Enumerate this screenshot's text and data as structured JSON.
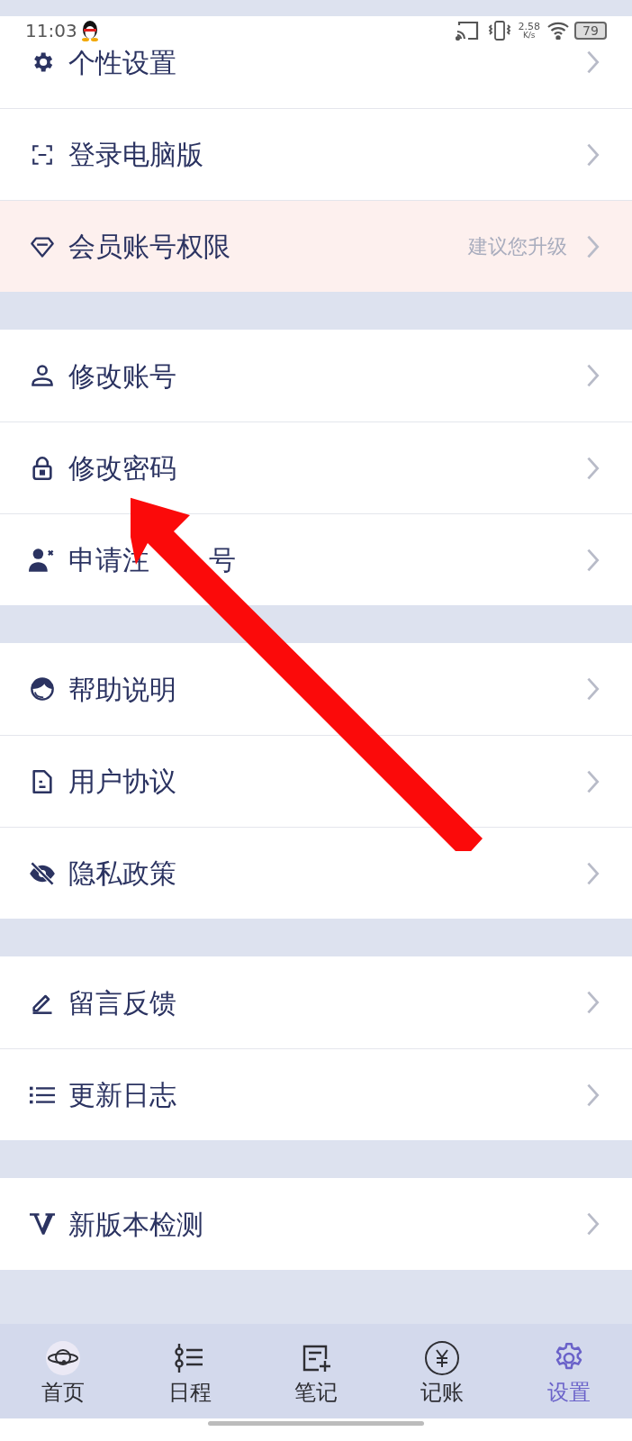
{
  "status_bar": {
    "time": "11:03",
    "net_speed": "2.58",
    "net_unit": "K/s",
    "battery": "79"
  },
  "sections": [
    {
      "rows": [
        {
          "label": "个性设置",
          "highlighted": false
        },
        {
          "label": "登录电脑版",
          "highlighted": false
        },
        {
          "label": "会员账号权限",
          "hint": "建议您升级",
          "highlighted": true
        }
      ]
    },
    {
      "rows": [
        {
          "label": "修改账号",
          "highlighted": false
        },
        {
          "label": "修改密码",
          "highlighted": false
        },
        {
          "label": "申请注",
          "label_tail": "号",
          "highlighted": false
        }
      ]
    },
    {
      "rows": [
        {
          "label": "帮助说明",
          "highlighted": false
        },
        {
          "label": "用户协议",
          "highlighted": false
        },
        {
          "label": "隐私政策",
          "highlighted": false
        }
      ]
    },
    {
      "rows": [
        {
          "label": "留言反馈",
          "highlighted": false
        },
        {
          "label": "更新日志",
          "highlighted": false
        }
      ]
    },
    {
      "rows": [
        {
          "label": "新版本检测",
          "highlighted": false
        }
      ]
    }
  ],
  "tabs": [
    {
      "label": "首页",
      "selected": false
    },
    {
      "label": "日程",
      "selected": false
    },
    {
      "label": "笔记",
      "selected": false
    },
    {
      "label": "记账",
      "selected": false
    },
    {
      "label": "设置",
      "selected": true
    }
  ]
}
